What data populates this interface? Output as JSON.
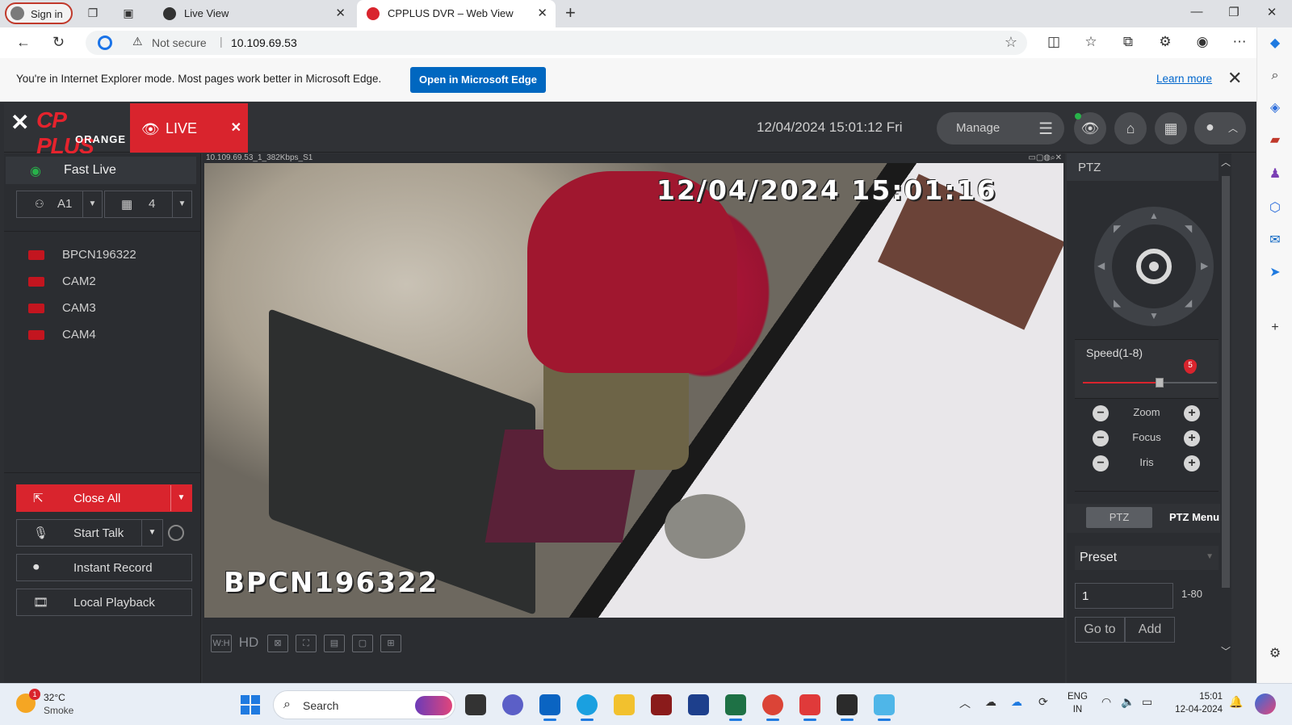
{
  "browser": {
    "signin_label": "Sign in",
    "tabs": [
      {
        "title": "Live View",
        "active": false
      },
      {
        "title": "CPPLUS DVR – Web View",
        "active": true
      }
    ],
    "address": {
      "security_label": "Not secure",
      "url": "10.109.69.53"
    },
    "ie_banner": {
      "message": "You're in Internet Explorer mode. Most pages work better in Microsoft Edge.",
      "open_button": "Open in Microsoft Edge",
      "learn_more": "Learn more"
    }
  },
  "dvr": {
    "brand": {
      "name": "CP PLUS",
      "sub": "ORANGE"
    },
    "live_tab_label": "LIVE",
    "datetime": "12/04/2024 15:01:12 Fri",
    "manage_label": "Manage",
    "left_panel": {
      "fast_live_label": "Fast Live",
      "stream_select": "A1",
      "layout_select": "4",
      "cameras": [
        "BPCN196322",
        "CAM2",
        "CAM3",
        "CAM4"
      ],
      "buttons": {
        "close_all": "Close All",
        "start_talk": "Start Talk",
        "instant_record": "Instant Record",
        "local_playback": "Local Playback"
      }
    },
    "video": {
      "stream_info": "10.109.69.53_1_382Kbps_S1",
      "osd_timestamp": "12/04/2024 15:01:16",
      "osd_camera_name": "BPCN196322",
      "toolbar_hd": "HD"
    },
    "ptz": {
      "title": "PTZ",
      "speed_label": "Speed(1-8)",
      "speed_value": "5",
      "speed_fraction": 0.57,
      "zoom_label": "Zoom",
      "focus_label": "Focus",
      "iris_label": "Iris",
      "mode_ptz": "PTZ",
      "mode_menu": "PTZ Menu",
      "preset_label": "Preset",
      "preset_value": "1",
      "preset_range": "1-80",
      "goto_label": "Go to",
      "add_label": "Add"
    }
  },
  "taskbar": {
    "weather_temp": "32°C",
    "weather_cond": "Smoke",
    "weather_badge": "1",
    "search_label": "Search",
    "lang_line1": "ENG",
    "lang_line2": "IN",
    "time": "15:01",
    "date": "12-04-2024"
  },
  "colors": {
    "dvr_red": "#d9242d",
    "dvr_bg": "#303236",
    "edge_blue": "#0067c0"
  }
}
